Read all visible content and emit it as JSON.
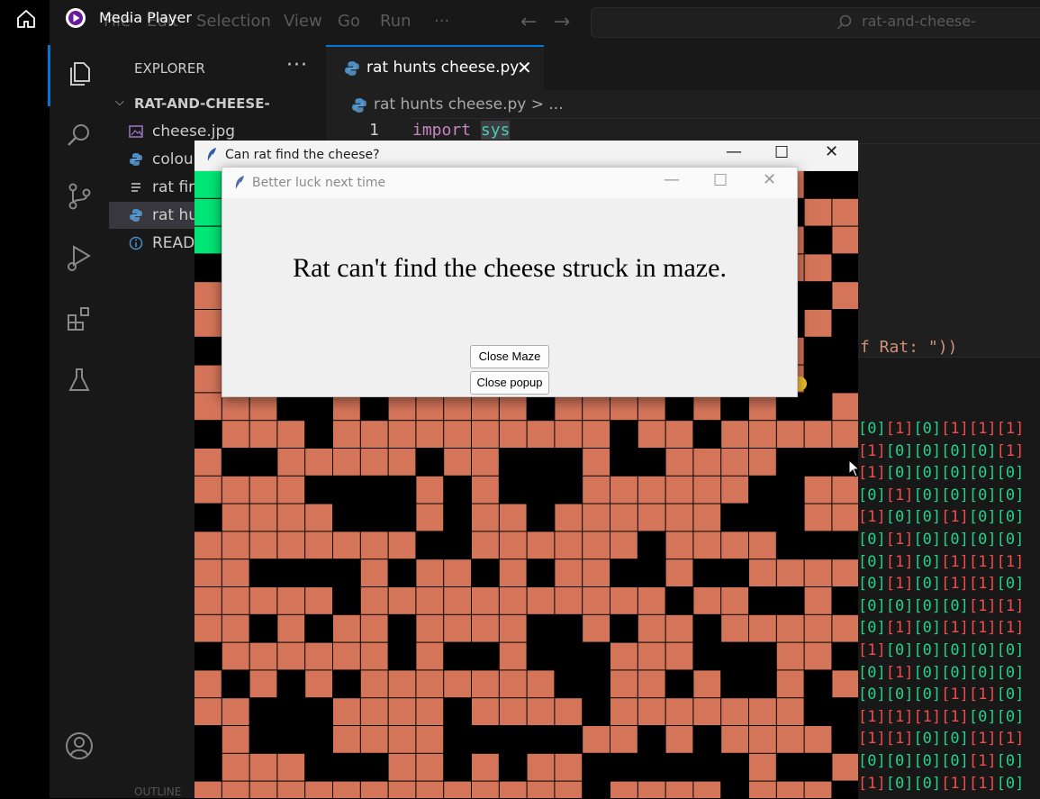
{
  "app": {
    "title": "Media Player",
    "menu": [
      "File",
      "Edit",
      "Selection",
      "View",
      "Go",
      "Run",
      "···"
    ],
    "search": "rat-and-cheese-"
  },
  "explorer": {
    "title": "EXPLORER",
    "more": "···",
    "folder": "RAT-AND-CHEESE-",
    "files": [
      {
        "label": "cheese.jpg",
        "icon": "image-icon"
      },
      {
        "label": "colou",
        "icon": "python-icon"
      },
      {
        "label": "rat fin",
        "icon": "text-file-icon"
      },
      {
        "label": "rat hu",
        "icon": "python-icon"
      },
      {
        "label": "READ",
        "icon": "info-icon"
      }
    ],
    "outline": "OUTLINE"
  },
  "editor": {
    "tab": "rat hunts cheese.py",
    "breadcrumb": "rat hunts cheese.py > ...",
    "line_number": "1",
    "keyword": "import",
    "module": "sys",
    "fragment": "f Rat: \"))"
  },
  "terminal_lines": [
    "[0][1][0][1][1][1]",
    "[1][0][0][0][0][1]",
    "[1][0][0][0][0][0]",
    "[0][1][0][0][0][0]",
    "[1][0][0][1][0][0]",
    "[0][1][0][0][0][0]",
    "[0][1][0][1][1][1]",
    "[0][1][0][1][1][0]",
    "[0][0][0][0][1][1]",
    "[0][1][0][1][1][1]",
    "[1][0][0][0][0][0]",
    "[0][1][0][0][0][0]",
    "[0][0][0][1][1][0]",
    "[1][1][1][1][0][0]",
    "[1][1][0][0][1][1]",
    "[0][0][0][0][1][0]",
    "[1][0][0][1][1][0]"
  ],
  "maze_window": {
    "title": "Can rat find the cheese?",
    "colors": {
      "open": "#d4755a",
      "wall": "#000000",
      "path": "#00e676",
      "cheese": "#f0c030"
    }
  },
  "popup": {
    "title": "Better luck next time",
    "message": "Rat can't find the cheese struck in maze.",
    "close_maze": "Close Maze",
    "close_popup": "Close popup"
  }
}
